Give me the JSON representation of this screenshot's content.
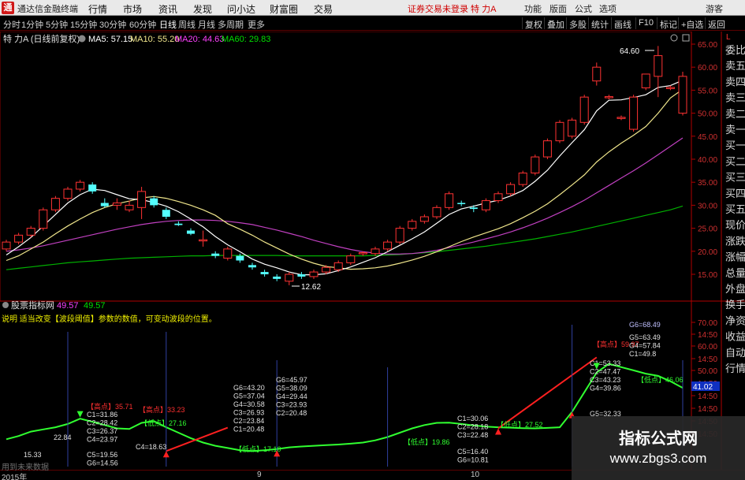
{
  "titlebar": {
    "app_name": "通达信金融终端",
    "menu": [
      "行情",
      "市场",
      "资讯",
      "发现",
      "问小达",
      "财富圈",
      "交易"
    ],
    "warning": "证券交易未登录  特 力A",
    "right_menu": [
      "功能",
      "版面",
      "公式",
      "选项",
      "游客"
    ]
  },
  "periods": [
    "分时",
    "1分钟",
    "5分钟",
    "15分钟",
    "30分钟",
    "60分钟",
    "日线",
    "周线",
    "月线",
    "多周期",
    "更多"
  ],
  "active_period": "日线",
  "toolbar": [
    "复权",
    "叠加",
    "多股",
    "统计",
    "画线",
    "F10",
    "标记",
    "+自选",
    "返回"
  ],
  "main_panel": {
    "title": "特 力A (日线前复权)",
    "ma": [
      {
        "label": "MA5: 57.15",
        "color": "#ffffff"
      },
      {
        "label": "MA10: 55.20",
        "color": "#f0e68c"
      },
      {
        "label": "MA20: 44.63",
        "color": "#ff40ff"
      },
      {
        "label": "MA60: 29.83",
        "color": "#00e000"
      }
    ],
    "high_label": "64.60",
    "low_label": "12.62",
    "yaxis": [
      "65.00",
      "60.00",
      "55.00",
      "50.00",
      "45.00",
      "40.00",
      "35.00",
      "30.00",
      "25.00",
      "20.00",
      "15.00"
    ]
  },
  "indicator_panel": {
    "title": "股票指标网",
    "v1": "49.57",
    "v2": "49.57",
    "note": "说明 适当改变【波段阈值】参数的数值，可变动波段的位置。",
    "current": "41.02",
    "yaxis": [
      "70.00",
      "14:50",
      "60.00",
      "14:50",
      "50.00",
      "14:50",
      "14:50",
      "14:50",
      "14:50",
      "14:50"
    ],
    "high_labels": [
      "【高点】35.71",
      "【高点】33.23",
      "【高点】59.97",
      "G6=68.49"
    ],
    "low_labels": [
      "【低点】27.16",
      "【低点】17.10",
      "【低点】19.86",
      "【低点】27.52",
      "【低点】46.06"
    ],
    "c_labels": [
      "C1=31.86",
      "C2=28.42",
      "C3=26.37",
      "C4=23.97",
      "C4=18.63",
      "C5=19.56",
      "G6=14.56",
      "G6=43.20",
      "G5=37.04",
      "G4=30.58",
      "C3=26.93",
      "C2=23.84",
      "C1=20.48",
      "G6=45.97",
      "G5=38.09",
      "G4=29.44",
      "C3=23.93",
      "C2=20.48",
      "C1=53.33",
      "C2=47.47",
      "C3=43.23",
      "G4=39.86",
      "C1=30.06",
      "C2=28.18",
      "C3=22.48",
      "G5=32.33",
      "C5=16.40",
      "G6=10.81",
      "G5=63.49",
      "G4=57.84",
      "C1=49.8",
      "22.84",
      "15.33"
    ]
  },
  "sidebar": [
    "委比",
    "卖五",
    "卖四",
    "卖三",
    "卖二",
    "卖一",
    "买一",
    "买二",
    "买三",
    "买四",
    "买五",
    "现价",
    "涨跌",
    "涨幅",
    "总量",
    "外盘",
    "换手",
    "净资",
    "收益",
    "自动",
    "行情"
  ],
  "dates": [
    "2015年",
    "9",
    "10"
  ],
  "bottom_hint": "用到未来数据",
  "watermark": {
    "line1": "指标公式网",
    "line2": "www.zbgs3.com"
  },
  "colors": {
    "up": "#ff3232",
    "down": "#54ffff",
    "ma5": "#ffffff",
    "ma10": "#f0e68c",
    "ma20": "#c040c0",
    "ma60": "#00b000",
    "axis_red": "#b00000"
  },
  "chart_data": {
    "type": "candlestick",
    "title": "特 力A (日线前复权)",
    "ylim": [
      12,
      66
    ],
    "candles": [
      {
        "o": 20.5,
        "h": 22.5,
        "l": 20.0,
        "c": 22.0
      },
      {
        "o": 22.0,
        "h": 24.0,
        "l": 21.5,
        "c": 23.5
      },
      {
        "o": 23.5,
        "h": 25.5,
        "l": 23.0,
        "c": 25.0
      },
      {
        "o": 25.0,
        "h": 29.5,
        "l": 24.5,
        "c": 29.0
      },
      {
        "o": 29.0,
        "h": 32.0,
        "l": 28.5,
        "c": 31.5
      },
      {
        "o": 31.5,
        "h": 34.0,
        "l": 31.0,
        "c": 33.5
      },
      {
        "o": 33.5,
        "h": 35.5,
        "l": 33.0,
        "c": 35.0
      },
      {
        "o": 34.5,
        "h": 35.0,
        "l": 32.5,
        "c": 33.0
      },
      {
        "o": 30.5,
        "h": 31.5,
        "l": 29.5,
        "c": 29.8
      },
      {
        "o": 30.0,
        "h": 31.5,
        "l": 29.0,
        "c": 30.5
      },
      {
        "o": 29.0,
        "h": 31.0,
        "l": 28.5,
        "c": 30.0
      },
      {
        "o": 29.5,
        "h": 34.0,
        "l": 27.0,
        "c": 33.0
      },
      {
        "o": 31.5,
        "h": 32.0,
        "l": 29.5,
        "c": 30.0
      },
      {
        "o": 29.0,
        "h": 29.5,
        "l": 27.0,
        "c": 27.5
      },
      {
        "o": 26.0,
        "h": 26.5,
        "l": 25.5,
        "c": 25.7
      },
      {
        "o": 24.5,
        "h": 25.0,
        "l": 23.5,
        "c": 23.8
      },
      {
        "o": 22.5,
        "h": 24.5,
        "l": 21.0,
        "c": 22.5
      },
      {
        "o": 19.5,
        "h": 20.0,
        "l": 18.5,
        "c": 19.0
      },
      {
        "o": 18.5,
        "h": 21.0,
        "l": 18.0,
        "c": 20.5
      },
      {
        "o": 19.0,
        "h": 19.5,
        "l": 17.5,
        "c": 18.0
      },
      {
        "o": 17.0,
        "h": 17.5,
        "l": 16.0,
        "c": 16.5
      },
      {
        "o": 15.5,
        "h": 16.0,
        "l": 14.5,
        "c": 15.0
      },
      {
        "o": 14.5,
        "h": 15.0,
        "l": 13.5,
        "c": 14.0
      },
      {
        "o": 13.5,
        "h": 15.5,
        "l": 12.62,
        "c": 15.0
      },
      {
        "o": 15.0,
        "h": 15.5,
        "l": 14.0,
        "c": 14.5
      },
      {
        "o": 14.5,
        "h": 16.0,
        "l": 14.0,
        "c": 15.5
      },
      {
        "o": 15.5,
        "h": 17.0,
        "l": 15.0,
        "c": 16.5
      },
      {
        "o": 16.0,
        "h": 18.0,
        "l": 15.5,
        "c": 17.5
      },
      {
        "o": 17.5,
        "h": 19.5,
        "l": 17.0,
        "c": 19.0
      },
      {
        "o": 19.5,
        "h": 20.0,
        "l": 19.0,
        "c": 19.7
      },
      {
        "o": 19.5,
        "h": 21.0,
        "l": 19.0,
        "c": 20.5
      },
      {
        "o": 20.5,
        "h": 22.5,
        "l": 20.0,
        "c": 22.0
      },
      {
        "o": 22.0,
        "h": 25.5,
        "l": 21.5,
        "c": 25.0
      },
      {
        "o": 25.0,
        "h": 27.0,
        "l": 24.5,
        "c": 26.5
      },
      {
        "o": 26.5,
        "h": 28.0,
        "l": 26.0,
        "c": 27.5
      },
      {
        "o": 27.5,
        "h": 30.0,
        "l": 27.0,
        "c": 29.5
      },
      {
        "o": 29.5,
        "h": 33.0,
        "l": 29.0,
        "c": 32.5
      },
      {
        "o": 30.5,
        "h": 31.0,
        "l": 29.8,
        "c": 30.3
      },
      {
        "o": 29.5,
        "h": 30.0,
        "l": 28.5,
        "c": 29.2
      },
      {
        "o": 29.0,
        "h": 31.5,
        "l": 28.5,
        "c": 31.0
      },
      {
        "o": 31.0,
        "h": 33.0,
        "l": 30.5,
        "c": 32.5
      },
      {
        "o": 32.5,
        "h": 35.0,
        "l": 32.0,
        "c": 34.5
      },
      {
        "o": 34.5,
        "h": 37.5,
        "l": 34.0,
        "c": 37.0
      },
      {
        "o": 37.0,
        "h": 41.0,
        "l": 36.5,
        "c": 40.5
      },
      {
        "o": 40.5,
        "h": 44.5,
        "l": 40.0,
        "c": 44.0
      },
      {
        "o": 44.0,
        "h": 48.5,
        "l": 43.5,
        "c": 48.0
      },
      {
        "o": 45.0,
        "h": 49.0,
        "l": 44.5,
        "c": 48.5
      },
      {
        "o": 48.0,
        "h": 54.0,
        "l": 47.5,
        "c": 53.5
      },
      {
        "o": 57.0,
        "h": 61.0,
        "l": 56.0,
        "c": 60.0
      },
      {
        "o": 53.5,
        "h": 54.0,
        "l": 53.0,
        "c": 53.6
      },
      {
        "o": 49.0,
        "h": 49.5,
        "l": 48.5,
        "c": 49.1
      },
      {
        "o": 46.5,
        "h": 54.0,
        "l": 46.0,
        "c": 53.5
      },
      {
        "o": 55.5,
        "h": 58.5,
        "l": 55.0,
        "c": 58.5
      },
      {
        "o": 58.0,
        "h": 64.6,
        "l": 53.5,
        "c": 62.5
      },
      {
        "o": 55.5,
        "h": 56.0,
        "l": 55.0,
        "c": 55.6
      },
      {
        "o": 50.0,
        "h": 59.0,
        "l": 49.5,
        "c": 58.0
      }
    ],
    "ma5": [
      19.2,
      21.0,
      23.0,
      25.5,
      28.0,
      30.5,
      32.3,
      33.5,
      33.2,
      32.3,
      31.4,
      31.2,
      30.6,
      29.8,
      28.6,
      27.0,
      25.3,
      23.2,
      21.4,
      19.9,
      18.3,
      17.2,
      16.4,
      15.5,
      14.9,
      14.9,
      15.1,
      15.8,
      16.6,
      17.6,
      18.6,
      19.9,
      21.3,
      22.7,
      24.2,
      26.1,
      28.0,
      29.2,
      29.8,
      30.5,
      31.1,
      32.0,
      33.2,
      35.2,
      37.6,
      40.7,
      43.6,
      46.4,
      50.5,
      52.8,
      52.9,
      53.4,
      54.0,
      55.6,
      56.0,
      57.15
    ],
    "ma10": [
      18.0,
      19.0,
      20.5,
      22.0,
      23.8,
      25.5,
      27.0,
      28.4,
      29.5,
      30.3,
      30.9,
      31.6,
      31.9,
      31.5,
      30.8,
      30.0,
      29.0,
      27.8,
      26.0,
      24.8,
      23.5,
      22.0,
      20.7,
      19.4,
      18.3,
      17.4,
      16.7,
      16.4,
      16.1,
      16.2,
      16.4,
      16.8,
      17.4,
      18.1,
      18.9,
      19.9,
      21.0,
      22.1,
      23.1,
      24.0,
      24.9,
      26.0,
      27.3,
      28.7,
      30.3,
      32.3,
      34.4,
      36.6,
      39.4,
      41.6,
      43.5,
      45.2,
      47.1,
      50.0,
      53.3,
      55.2
    ],
    "ma20": [
      20.0,
      20.3,
      20.7,
      21.2,
      21.8,
      22.4,
      23.0,
      23.6,
      24.2,
      24.8,
      25.3,
      25.8,
      26.2,
      26.5,
      26.7,
      26.8,
      26.8,
      26.7,
      26.5,
      26.2,
      25.8,
      25.2,
      24.6,
      23.9,
      23.2,
      22.4,
      21.7,
      21.0,
      20.4,
      19.9,
      19.6,
      19.4,
      19.4,
      19.5,
      19.8,
      20.2,
      20.8,
      21.4,
      22.0,
      22.7,
      23.4,
      24.2,
      25.1,
      26.1,
      27.2,
      28.4,
      29.7,
      31.1,
      32.7,
      34.3,
      35.9,
      37.5,
      39.2,
      41.0,
      42.8,
      44.63
    ],
    "ma60": [
      16.0,
      16.3,
      16.6,
      16.9,
      17.2,
      17.5,
      17.7,
      17.9,
      18.1,
      18.3,
      18.5,
      18.6,
      18.7,
      18.8,
      18.9,
      19.0,
      19.0,
      19.1,
      19.1,
      19.1,
      19.1,
      19.1,
      19.1,
      19.0,
      19.0,
      19.0,
      19.0,
      19.0,
      19.0,
      19.0,
      19.1,
      19.2,
      19.3,
      19.5,
      19.7,
      19.9,
      20.2,
      20.5,
      20.8,
      21.1,
      21.5,
      21.9,
      22.3,
      22.7,
      23.2,
      23.7,
      24.2,
      24.8,
      25.4,
      26.0,
      26.6,
      27.2,
      27.8,
      28.4,
      29.0,
      29.83
    ],
    "indicator": {
      "ylim": [
        10,
        72
      ],
      "green_zigzag": [
        22.5,
        24.0,
        26.0,
        27.0,
        28.0,
        29.5,
        31.9,
        30.5,
        29.0,
        27.5,
        27.2,
        30.0,
        30.8,
        28.0,
        25.5,
        23.0,
        21.0,
        19.5,
        18.5,
        17.5,
        17.1,
        17.5,
        18.0,
        18.8,
        19.2,
        19.5,
        19.8,
        20.1,
        20.5,
        21.0,
        22.0,
        23.5,
        25.5,
        27.5,
        29.0,
        30.0,
        30.1,
        29.5,
        28.8,
        28.3,
        28.0,
        27.8,
        27.6,
        27.5,
        27.7,
        28.0,
        35.0,
        44.0,
        53.0,
        57.0,
        55.5,
        54.0,
        52.5,
        51.5,
        49.0,
        46.0
      ],
      "red_segments": [
        [
          13,
          17.1,
          18,
          27.8
        ],
        [
          40,
          27.5,
          48,
          59.97
        ]
      ]
    }
  }
}
